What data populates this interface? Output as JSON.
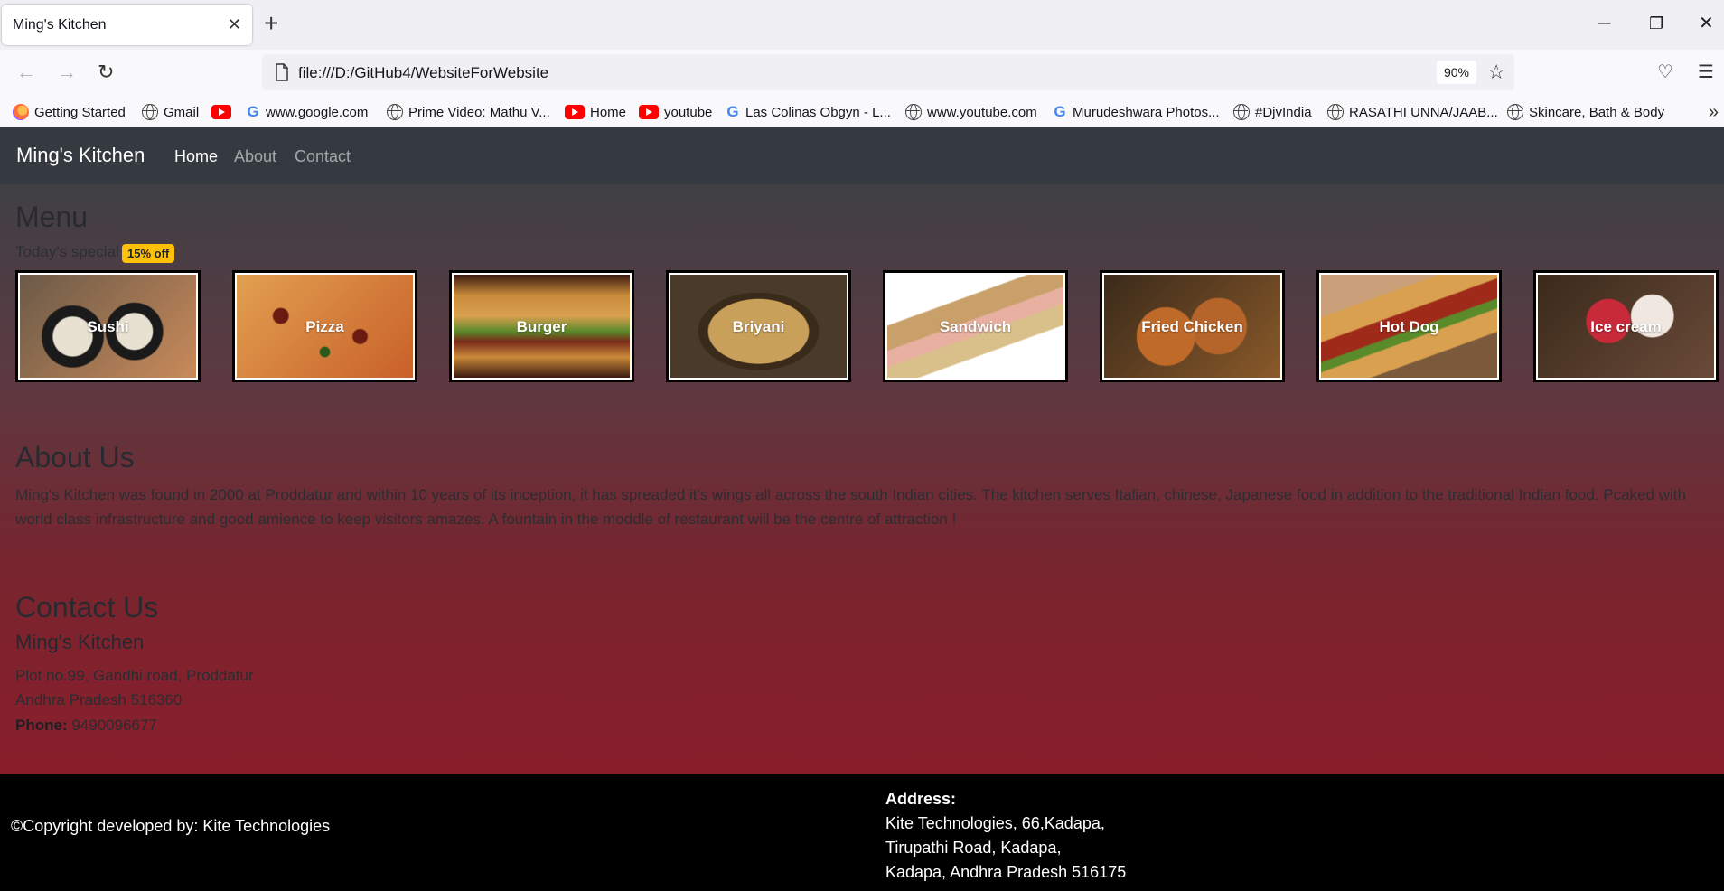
{
  "browser": {
    "tab_title": "Ming's Kitchen",
    "url": "file:///D:/GitHub4/WebsiteForWebsite",
    "zoom": "90%",
    "bookmarks": [
      {
        "label": "Getting Started",
        "icon": "firefox-icon"
      },
      {
        "label": "Gmail",
        "icon": "globe-icon"
      },
      {
        "label": "",
        "icon": "youtube-icon"
      },
      {
        "label": "www.google.com",
        "icon": "google-icon"
      },
      {
        "label": "Prime Video: Mathu V...",
        "icon": "globe-icon"
      },
      {
        "label": "Home",
        "icon": "youtube-icon"
      },
      {
        "label": "youtube",
        "icon": "youtube-icon"
      },
      {
        "label": "Las Colinas Obgyn - L...",
        "icon": "google-icon"
      },
      {
        "label": "www.youtube.com",
        "icon": "globe-icon"
      },
      {
        "label": "Murudeshwara Photos...",
        "icon": "google-icon"
      },
      {
        "label": "#DjvIndia",
        "icon": "globe-icon"
      },
      {
        "label": "RASATHI UNNA/JAAB...",
        "icon": "globe-icon"
      },
      {
        "label": "Skincare, Bath & Body",
        "icon": "globe-icon"
      }
    ]
  },
  "site": {
    "brand": "Ming's Kitchen",
    "nav": [
      "Home",
      "About",
      "Contact"
    ],
    "menu": {
      "heading": "Menu",
      "special_text": "Today's special",
      "badge": "15% off",
      "items": [
        {
          "label": "Sushi",
          "color": "#6b5a48"
        },
        {
          "label": "Pizza",
          "color": "#d07a3c"
        },
        {
          "label": "Burger",
          "color": "#8a3a22"
        },
        {
          "label": "Briyani",
          "color": "#9a7a3a"
        },
        {
          "label": "Sandwich",
          "color": "#c9b59a"
        },
        {
          "label": "Fried Chicken",
          "color": "#b5652a"
        },
        {
          "label": "Hot Dog",
          "color": "#9a6a48"
        },
        {
          "label": "Ice cream",
          "color": "#5a3a2a"
        }
      ]
    },
    "about": {
      "heading": "About Us",
      "text": "Ming's Kitchen was found in 2000 at Proddatur and within 10 years of its inception, it has spreaded it's wings all across the south Indian cities. The kitchen serves Italian, chinese, Japanese food in addition to the traditional Indian food. Pcaked with world class infrastructure and good amience to keep visitors amazes. A fountain in the moddle of restaurant will be the centre of attraction !"
    },
    "contact": {
      "heading": "Contact Us",
      "name": "Ming's Kitchen",
      "line1": "Plot no.99, Gandhi road, Proddatur",
      "line2": "Andhra Pradesh 516360",
      "phone_label": "Phone:",
      "phone": "9490096677"
    },
    "footer": {
      "copyright": "©Copyright developed by: Kite Technologies",
      "address_label": "Address:",
      "address_lines": [
        "Kite Technologies, 66,Kadapa,",
        "Tirupathi Road, Kadapa,",
        "Kadapa, Andhra Pradesh 516175"
      ]
    }
  }
}
